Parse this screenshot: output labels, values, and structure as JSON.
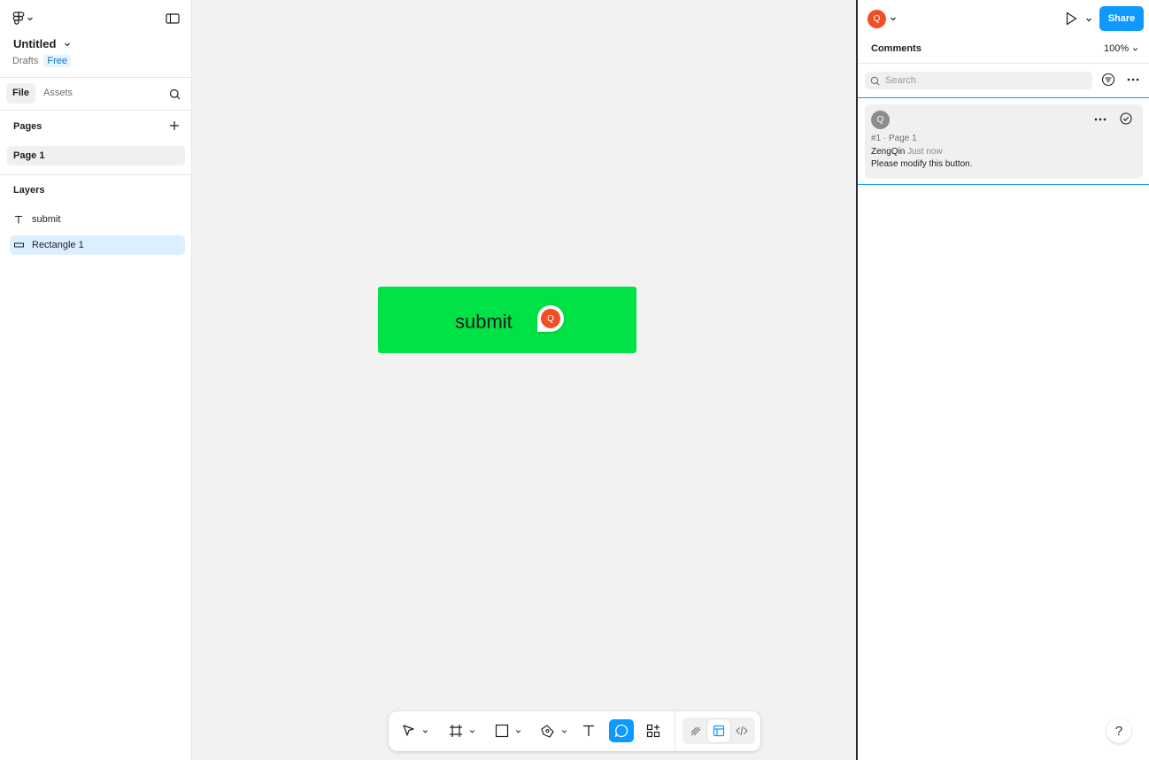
{
  "file": {
    "name": "Untitled",
    "location": "Drafts",
    "plan_badge": "Free"
  },
  "left_tabs": {
    "file": "File",
    "assets": "Assets"
  },
  "pages": {
    "title": "Pages",
    "items": [
      {
        "label": "Page 1",
        "selected": true
      }
    ]
  },
  "layers": {
    "title": "Layers",
    "items": [
      {
        "label": "submit",
        "icon": "text-icon",
        "selected": false
      },
      {
        "label": "Rectangle 1",
        "icon": "rectangle-icon",
        "selected": true
      }
    ]
  },
  "canvas": {
    "button_text": "submit",
    "button_color": "#00e245",
    "comment_pin_initial": "Q"
  },
  "toolbar": {
    "active_tool": "comment",
    "tools": [
      "move",
      "frame",
      "shape",
      "pen",
      "text",
      "comment",
      "actions"
    ],
    "modes": [
      "draw",
      "design",
      "dev"
    ],
    "active_mode": "design"
  },
  "right_header": {
    "user_initial": "Q",
    "share_label": "Share"
  },
  "comments_panel": {
    "title": "Comments",
    "zoom": "100%",
    "search_placeholder": "Search"
  },
  "thread": {
    "avatar_initial": "Q",
    "meta": "#1 · Page 1",
    "author": "ZengQin",
    "time": "Just now",
    "body": "Please modify this button."
  },
  "help_label": "?",
  "colors": {
    "accent": "#0d99ff",
    "user_avatar": "#f04e23",
    "rectangle_fill": "#00e245"
  }
}
